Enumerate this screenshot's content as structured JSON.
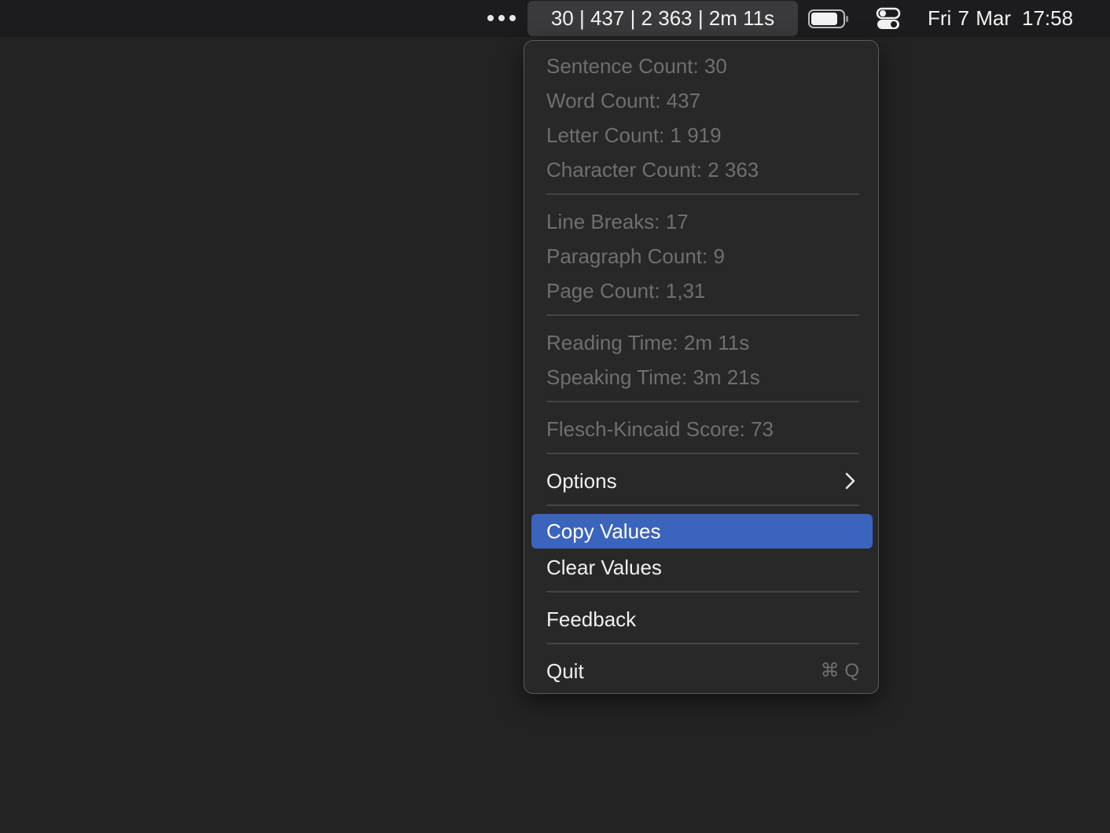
{
  "menubar": {
    "more_icon": "ellipsis-icon",
    "status_text": "30 | 437 | 2 363 | 2m 11s",
    "battery_icon": "battery-icon",
    "control_center_icon": "control-center-icon",
    "date": "Fri 7 Mar",
    "time": "17:58"
  },
  "menu": {
    "stats": [
      "Sentence Count: 30",
      "Word Count: 437",
      "Letter Count: 1 919",
      "Character Count: 2 363",
      "Line Breaks: 17",
      "Paragraph Count: 9",
      "Page Count: 1,31",
      "Reading Time: 2m 11s",
      "Speaking Time: 3m 21s",
      "Flesch-Kincaid Score: 73"
    ],
    "options_label": "Options",
    "copy_values_label": "Copy Values",
    "clear_values_label": "Clear Values",
    "feedback_label": "Feedback",
    "quit_label": "Quit",
    "quit_shortcut": "⌘ Q"
  },
  "colors": {
    "highlight": "#3a64bd",
    "menu_background": "#282828",
    "disabled_text": "#6f6f6f"
  }
}
